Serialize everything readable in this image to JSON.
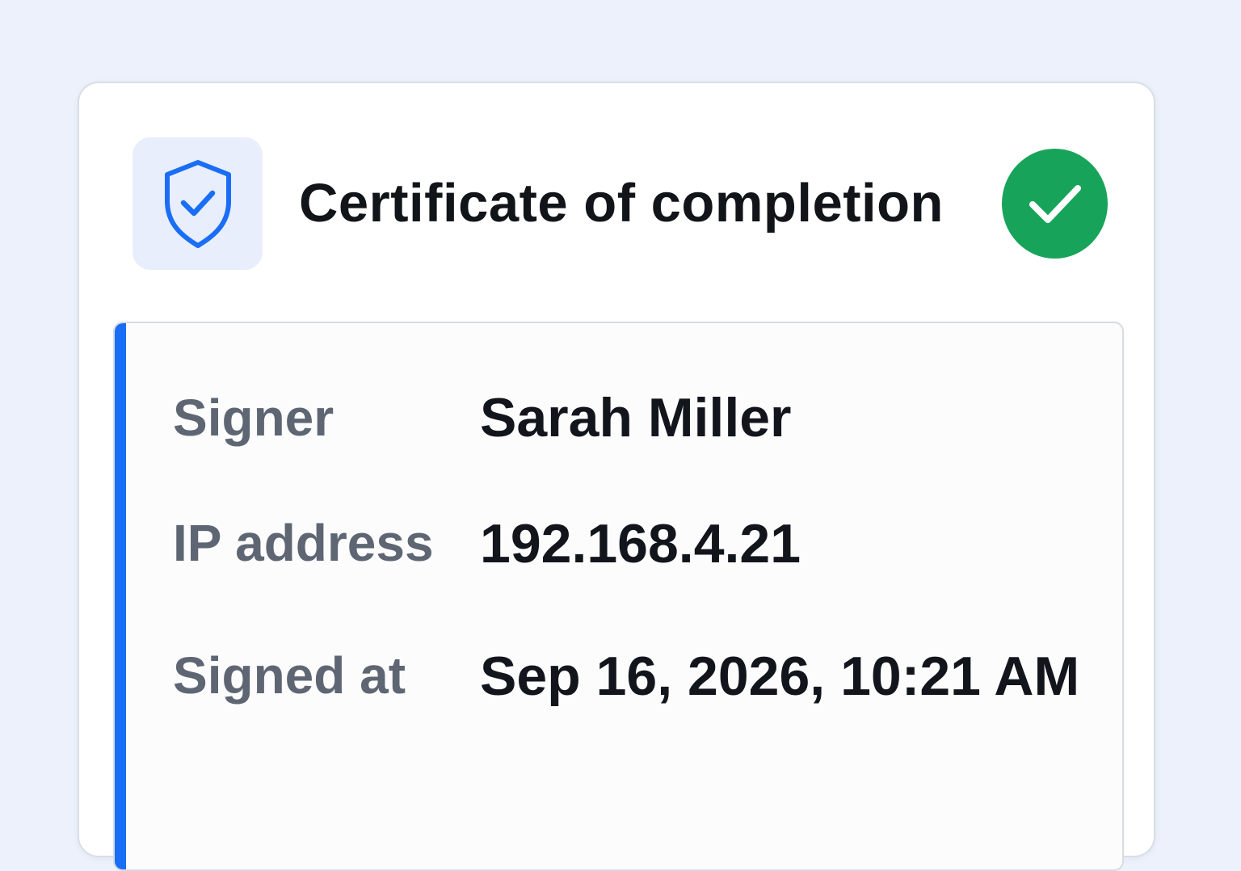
{
  "certificate": {
    "title": "Certificate of completion",
    "header_icon": "shield-check-icon",
    "status_icon": "check-circle-icon",
    "status_color": "#17a45a",
    "accent_color": "#1a6ef5"
  },
  "fields": [
    {
      "label": "Signer",
      "value": "Sarah Miller"
    },
    {
      "label": "IP address",
      "value": "192.168.4.21"
    },
    {
      "label": "Signed at",
      "value": "Sep 16, 2026, 10:21 AM"
    }
  ]
}
